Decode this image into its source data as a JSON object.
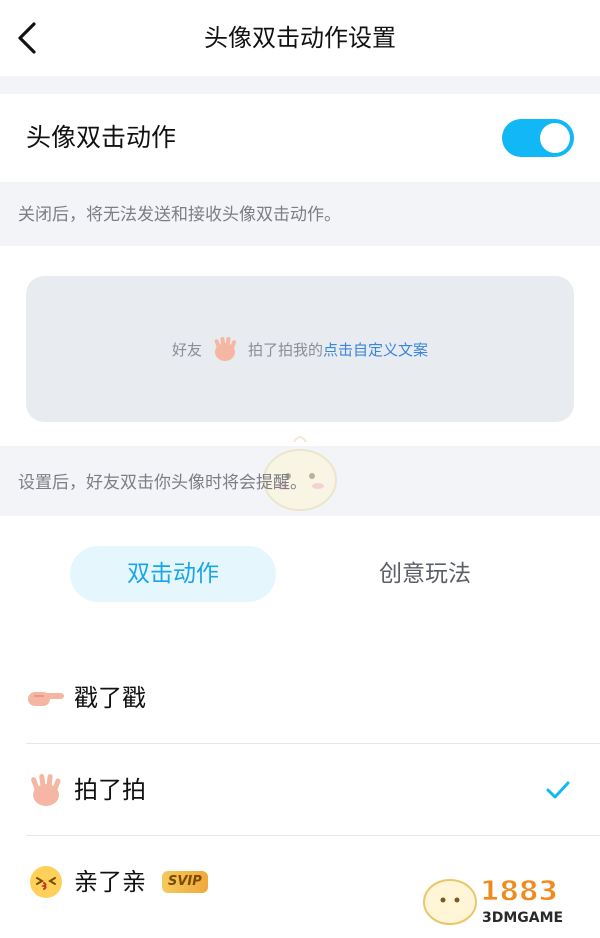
{
  "header": {
    "title": "头像双击动作设置"
  },
  "toggle": {
    "label": "头像双击动作",
    "on": true
  },
  "hint_close": "关闭后，将无法发送和接收头像双击动作。",
  "preview": {
    "prefix": "好友",
    "middle": "拍了拍我的",
    "link": "点击自定义文案"
  },
  "hint_set": "设置后，好友双击你头像时将会提醒。",
  "tabs": [
    {
      "label": "双击动作",
      "active": true
    },
    {
      "label": "创意玩法",
      "active": false
    }
  ],
  "actions": [
    {
      "label": "戳了戳",
      "icon": "pointing-hand-icon",
      "selected": false
    },
    {
      "label": "拍了拍",
      "icon": "waving-hand-icon",
      "selected": true
    },
    {
      "label": "亲了亲",
      "icon": "kiss-face-icon",
      "badge": "SVIP",
      "selected": false
    }
  ],
  "watermark": {
    "text": "1883",
    "sub": "3DMGAME"
  },
  "colors": {
    "accent": "#12b7f5",
    "link": "#3a86d8",
    "tab_active_bg": "#e6f6fd"
  }
}
